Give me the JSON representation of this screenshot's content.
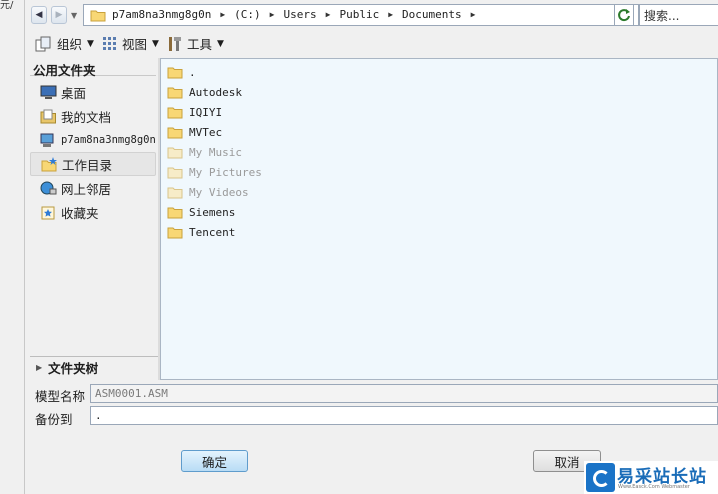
{
  "edge_label": "元/",
  "address_bar": {
    "crumbs": [
      "p7am8na3nmg8g0n",
      "(C:)",
      "Users",
      "Public",
      "Documents"
    ]
  },
  "search": {
    "placeholder": "搜索..."
  },
  "toolbar": {
    "organize": "组织",
    "views": "视图",
    "tools": "工具"
  },
  "nav_pane": {
    "header": "公用文件夹",
    "items": [
      {
        "label": "桌面",
        "icon": "desktop-icon"
      },
      {
        "label": "我的文档",
        "icon": "documents-icon"
      },
      {
        "label": "p7am8na3nmg8g0n",
        "icon": "computer-icon"
      },
      {
        "label": "工作目录",
        "icon": "working-directory-icon"
      },
      {
        "label": "网上邻居",
        "icon": "network-icon"
      },
      {
        "label": "收藏夹",
        "icon": "favorites-icon"
      }
    ],
    "folder_tree": "文件夹树"
  },
  "files": [
    {
      "name": ".",
      "dim": false
    },
    {
      "name": "Autodesk",
      "dim": false
    },
    {
      "name": "IQIYI",
      "dim": false
    },
    {
      "name": "MVTec",
      "dim": false
    },
    {
      "name": "My Music",
      "dim": true
    },
    {
      "name": "My Pictures",
      "dim": true
    },
    {
      "name": "My Videos",
      "dim": true
    },
    {
      "name": "Siemens",
      "dim": false
    },
    {
      "name": "Tencent",
      "dim": false
    }
  ],
  "model_name": {
    "label": "模型名称",
    "value": "ASM0001.ASM"
  },
  "backup_to": {
    "label": "备份到",
    "value": "."
  },
  "buttons": {
    "ok": "确定",
    "cancel": "取消"
  },
  "watermark": {
    "title": "易采站长站",
    "subtitle": "Www.Easck.Com Webmaster"
  }
}
